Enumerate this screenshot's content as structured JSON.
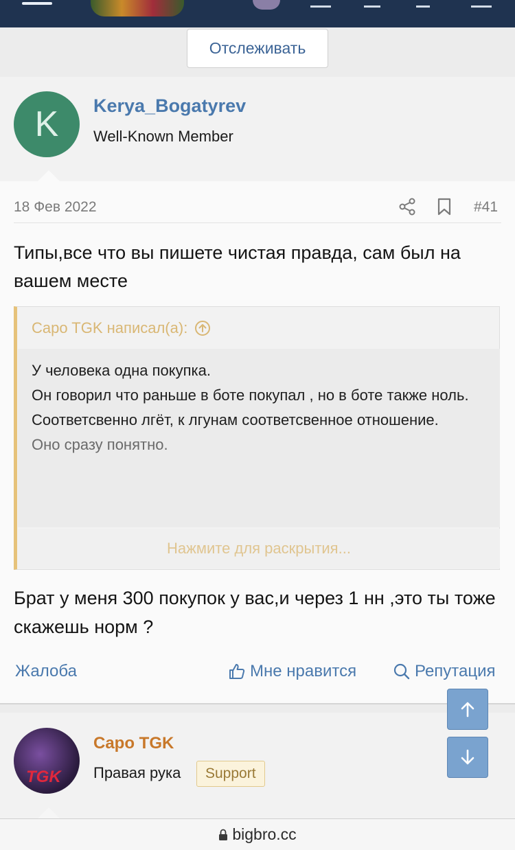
{
  "header": {
    "icons": [
      "menu-icon",
      "logo",
      "user-avatar",
      "inbox-icon",
      "bell-icon",
      "pen-icon",
      "search-icon"
    ]
  },
  "follow_button": "Отслеживать",
  "post": {
    "author": "Kerya_Bogatyrev",
    "author_initial": "K",
    "author_title": "Well-Known Member",
    "date": "18 Фев 2022",
    "number": "#41",
    "body_1": "Типы,все что вы пишете чистая правда, сам был на вашем месте",
    "quote": {
      "header": "Capo TGK написал(а):",
      "lines": [
        "У человека одна покупка.",
        "Он говорил что раньше в боте покупал , но в боте также ноль.",
        "Соответсвенно лгёт, к лгунам соответсвенное отношение.",
        "Оно сразу понятно."
      ],
      "expand_label": "Нажмите для раскрытия..."
    },
    "body_2": "Брат у меня 300 покупок у вас,и через 1 нн ,это ты тоже скажешь норм ?",
    "actions": {
      "report": "Жалоба",
      "like": "Мне нравится",
      "reputation": "Репутация"
    }
  },
  "next_post": {
    "author": "Capo TGK",
    "author_title": "Правая рука",
    "badge": "Support",
    "avatar_text": "TGK"
  },
  "url_bar": {
    "domain": "bigbro.cc"
  },
  "colors": {
    "header_bg": "#1f3350",
    "link": "#4a79ad",
    "quote_accent": "#e6c27a",
    "scroll_button": "#7aa3cf"
  }
}
